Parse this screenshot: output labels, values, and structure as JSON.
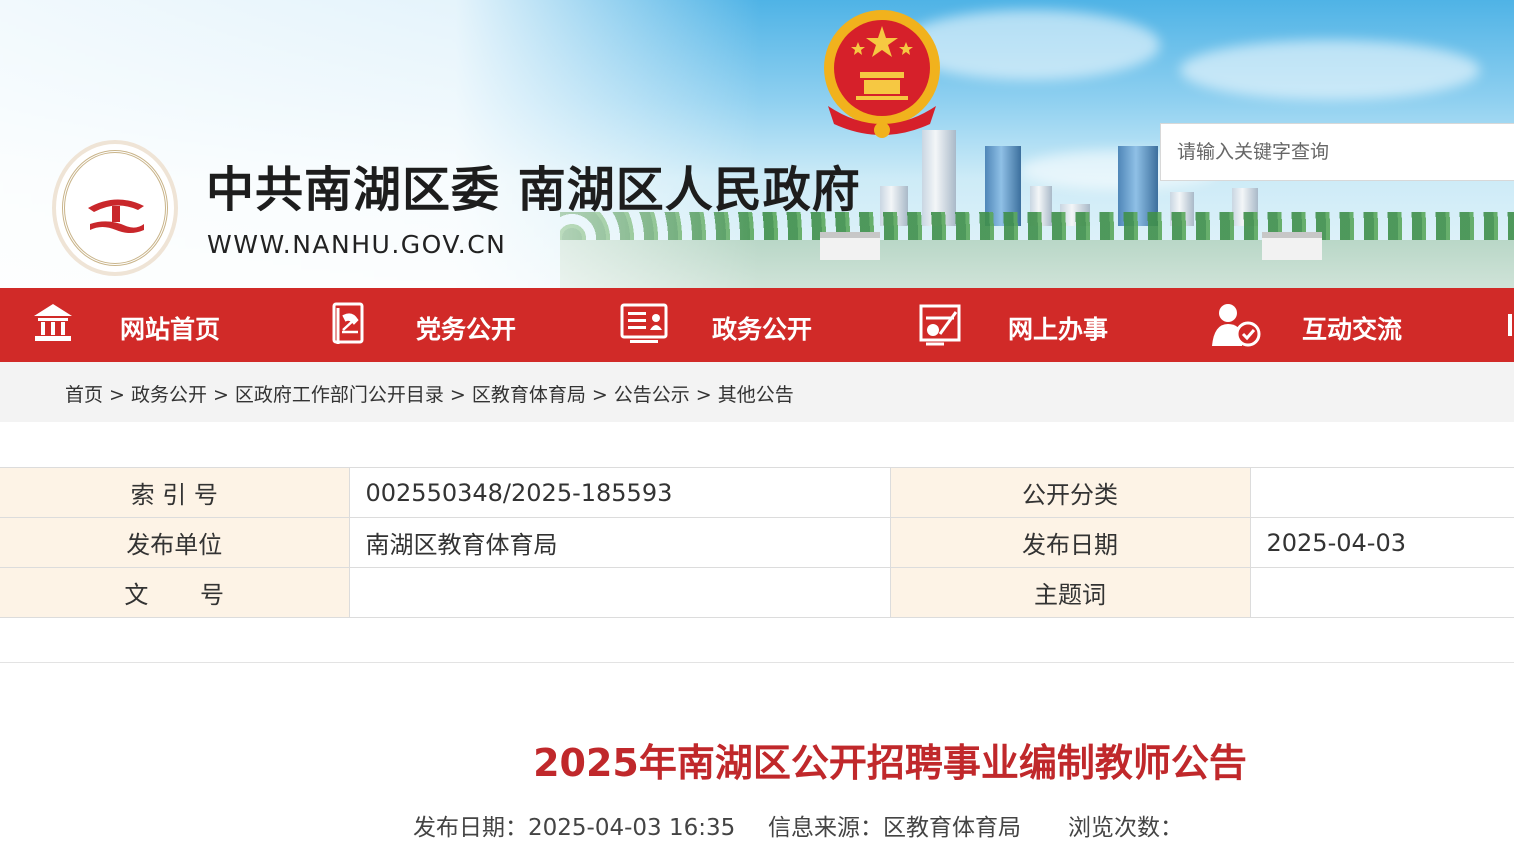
{
  "header": {
    "site_title": "中共南湖区委 南湖区人民政府",
    "site_url": "WWW.NANHU.GOV.CN",
    "search_placeholder": "请输入关键字查询"
  },
  "nav": {
    "items": [
      {
        "label": "网站首页",
        "icon": "home-icon"
      },
      {
        "label": "党务公开",
        "icon": "party-book-icon"
      },
      {
        "label": "政务公开",
        "icon": "id-card-icon"
      },
      {
        "label": "网上办事",
        "icon": "online-service-icon"
      },
      {
        "label": "互动交流",
        "icon": "users-chat-icon"
      }
    ]
  },
  "breadcrumb": {
    "items": [
      "首页",
      "政务公开",
      "区政府工作部门公开目录",
      "区教育体育局",
      "公告公示",
      "其他公告"
    ],
    "separator": ">"
  },
  "info_table": {
    "index_label": "索 引 号",
    "index_value": "002550348/2025-185593",
    "category_label": "公开分类",
    "category_value": "",
    "publisher_label": "发布单位",
    "publisher_value": "南湖区教育体育局",
    "date_label": "发布日期",
    "date_value": "2025-04-03",
    "doc_no_label": "文 号",
    "doc_no_value": "",
    "keywords_label": "主题词",
    "keywords_value": ""
  },
  "article": {
    "title": "2025年南湖区公开招聘事业编制教师公告",
    "publish_date_label": "发布日期：",
    "publish_date_value": "2025-04-03 16:35",
    "source_label": "信息来源：",
    "source_value": "区教育体育局",
    "views_label": "浏览次数："
  },
  "colors": {
    "nav_red": "#d12a28",
    "title_red": "#c0282b",
    "key_cell_bg": "#fdf3e6"
  }
}
